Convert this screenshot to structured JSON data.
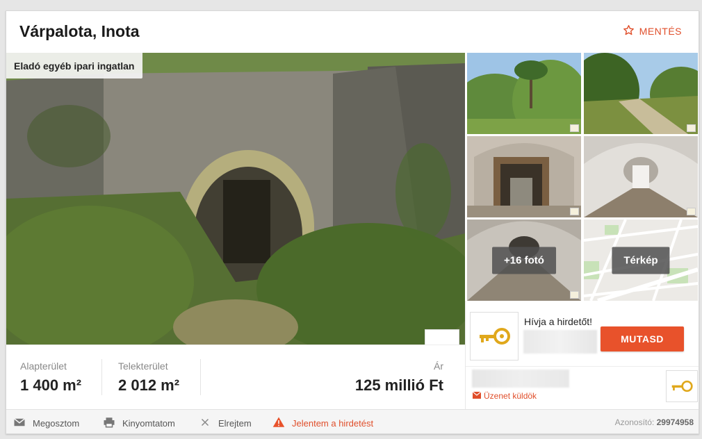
{
  "header": {
    "title": "Várpalota, Inota",
    "save_label": "MENTÉS"
  },
  "main_photo": {
    "category": "Eladó egyéb ipari ingatlan"
  },
  "thumbnails": {
    "more_photos_label": "+16 fotó",
    "map_label": "Térkép"
  },
  "stats": {
    "floor_area_label": "Alapterület",
    "floor_area_value": "1 400 m²",
    "plot_area_label": "Telekterület",
    "plot_area_value": "2 012 m²",
    "price_label": "Ár",
    "price_value": "125 millió Ft"
  },
  "contact": {
    "call_text": "Hívja a hirdetőt!",
    "show_button": "MUTASD",
    "send_message": "Üzenet küldök"
  },
  "footer": {
    "share": "Megosztom",
    "print": "Kinyomtatom",
    "hide": "Elrejtem",
    "report": "Jelentem a hirdetést",
    "id_label": "Azonosító:",
    "id_value": "29974958"
  },
  "colors": {
    "accent": "#e8522b",
    "link": "#e04e2a"
  },
  "icons": {
    "save": "star-outline-icon",
    "share": "mail-icon",
    "print": "printer-icon",
    "hide": "close-icon",
    "report": "warning-icon",
    "message": "envelope-icon"
  }
}
